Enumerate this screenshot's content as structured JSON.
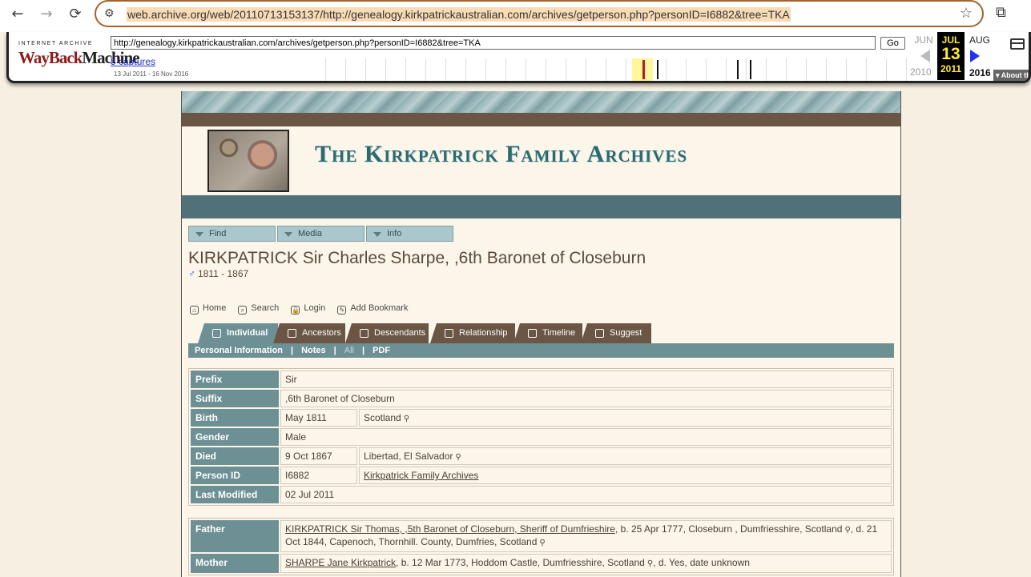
{
  "browser": {
    "back_icon": "←",
    "forward_icon": "→",
    "reload_icon": "⟳",
    "site_icon": "⚙",
    "url": "web.archive.org/web/20110713153137/http://genealogy.kirkpatrickaustralian.com/archives/getperson.php?personID=I6882&tree=TKA",
    "star_icon": "☆",
    "extensions_icon": "⧉"
  },
  "wayback": {
    "logo_top": "INTERNET ARCHIVE",
    "logo_main_red": "WayBack",
    "logo_main_dark": "Machine",
    "url_input": "http://genealogy.kirkpatrickaustralian.com/archives/getperson.php?personID=I6882&tree=TKA",
    "go_label": "Go",
    "captures_label": "5 captures",
    "date_range": "13 Jul 2011 - 16 Nov 2016",
    "prev_month": "JUN",
    "cur_month": "JUL",
    "cur_day": "13",
    "cur_year": "2011",
    "next_month": "AUG",
    "prev_year": "2010",
    "next_year": "2016",
    "about_label": "▾ About th"
  },
  "site": {
    "title": "The Kirkpatrick Family Archives",
    "menus": [
      "Find",
      "Media",
      "Info"
    ]
  },
  "person": {
    "name": "KIRKPATRICK Sir Charles Sharpe, ,6th Baronet of Closeburn",
    "gender_symbol": "♂",
    "dates": "1811 - 1867"
  },
  "links": [
    {
      "label": "Home",
      "icon": "⌂"
    },
    {
      "label": "Search",
      "icon": "⌕"
    },
    {
      "label": "Login",
      "icon": "🔒"
    },
    {
      "label": "Add Bookmark",
      "icon": "✎"
    }
  ],
  "tabs": [
    "Individual",
    "Ancestors",
    "Descendants",
    "Relationship",
    "Timeline",
    "Suggest"
  ],
  "subtabs": {
    "personal": "Personal Information",
    "notes": "Notes",
    "all": "All",
    "pdf": "PDF",
    "sep": "|"
  },
  "info_rows": {
    "prefix": {
      "label": "Prefix",
      "value": "Sir"
    },
    "suffix": {
      "label": "Suffix",
      "value": ",6th Baronet of Closeburn"
    },
    "birth": {
      "label": "Birth",
      "date": "May 1811",
      "place": "Scotland"
    },
    "gender": {
      "label": "Gender",
      "value": "Male"
    },
    "died": {
      "label": "Died",
      "date": "9 Oct 1867",
      "place": "Libertad, El Salvador"
    },
    "person_id": {
      "label": "Person ID",
      "value": "I6882",
      "tree": "Kirkpatrick Family Archives"
    },
    "modified": {
      "label": "Last Modified",
      "value": "02 Jul 2011"
    }
  },
  "family": {
    "father": {
      "label": "Father",
      "name": "KIRKPATRICK Sir Thomas, ,5th Baronet of Closeburn, Sheriff of Dumfrieshire",
      "details_a": ",   b. 25 Apr 1777, Closeburn , Dumfriesshire, Scotland",
      "details_b": ",   d. 21 Oct 1844, Capenoch, Thornhill. County, Dumfries, Scotland"
    },
    "mother": {
      "label": "Mother",
      "name": "SHARPE Jane Kirkpatrick",
      "details_a": ",   b. 12 Mar 1773, Hoddom Castle, Dumfriesshire, Scotland",
      "details_b": ",   d. Yes, date unknown"
    }
  },
  "magnifier_icon": "⚲"
}
